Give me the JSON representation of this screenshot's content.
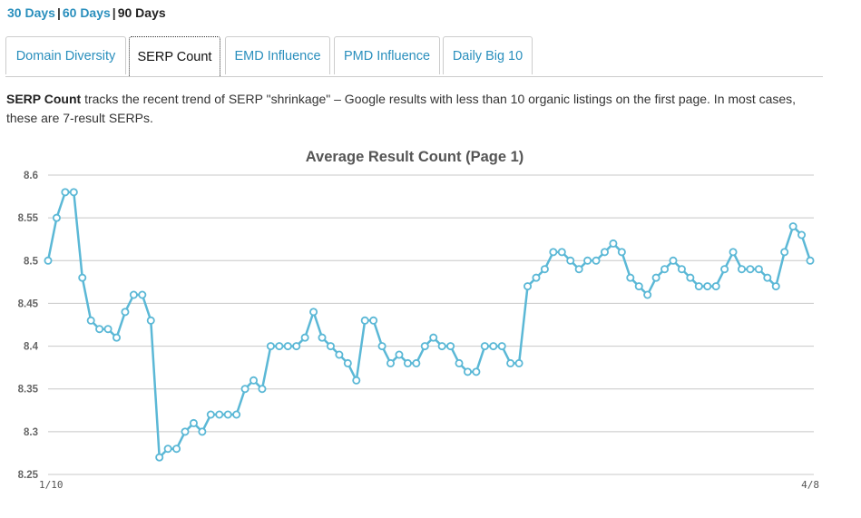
{
  "ranges": {
    "items": [
      {
        "label": "30 Days"
      },
      {
        "label": "60 Days"
      },
      {
        "label": "90 Days"
      }
    ],
    "separator": "|"
  },
  "tabs": [
    {
      "label": "Domain Diversity"
    },
    {
      "label": "SERP Count"
    },
    {
      "label": "EMD Influence"
    },
    {
      "label": "PMD Influence"
    },
    {
      "label": "Daily Big 10"
    }
  ],
  "description": {
    "lead": "SERP Count",
    "text": " tracks the recent trend of SERP \"shrinkage\" – Google results with less than 10 organic listings on the first page. In most cases, these are 7-result SERPs."
  },
  "colors": {
    "link": "#2a8fbd",
    "series": "#5bb8d6"
  },
  "chart_data": {
    "type": "line",
    "title": "Average Result Count (Page 1)",
    "ylim": [
      8.25,
      8.6
    ],
    "yticks": [
      "8.25",
      "8.3",
      "8.35",
      "8.4",
      "8.45",
      "8.5",
      "8.55",
      "8.6"
    ],
    "xticks": [
      "1/10",
      "4/8"
    ],
    "grid": true,
    "series": [
      {
        "values": [
          8.5,
          8.55,
          8.58,
          8.58,
          8.48,
          8.43,
          8.42,
          8.42,
          8.41,
          8.44,
          8.46,
          8.46,
          8.43,
          8.27,
          8.28,
          8.28,
          8.3,
          8.31,
          8.3,
          8.32,
          8.32,
          8.32,
          8.32,
          8.35,
          8.36,
          8.35,
          8.4,
          8.4,
          8.4,
          8.4,
          8.41,
          8.44,
          8.41,
          8.4,
          8.39,
          8.38,
          8.36,
          8.43,
          8.43,
          8.4,
          8.38,
          8.39,
          8.38,
          8.38,
          8.4,
          8.41,
          8.4,
          8.4,
          8.38,
          8.37,
          8.37,
          8.4,
          8.4,
          8.4,
          8.38,
          8.38,
          8.47,
          8.48,
          8.49,
          8.51,
          8.51,
          8.5,
          8.49,
          8.5,
          8.5,
          8.51,
          8.52,
          8.51,
          8.48,
          8.47,
          8.46,
          8.48,
          8.49,
          8.5,
          8.49,
          8.48,
          8.47,
          8.47,
          8.47,
          8.49,
          8.51,
          8.49,
          8.49,
          8.49,
          8.48,
          8.47,
          8.51,
          8.54,
          8.53,
          8.5
        ]
      }
    ]
  }
}
